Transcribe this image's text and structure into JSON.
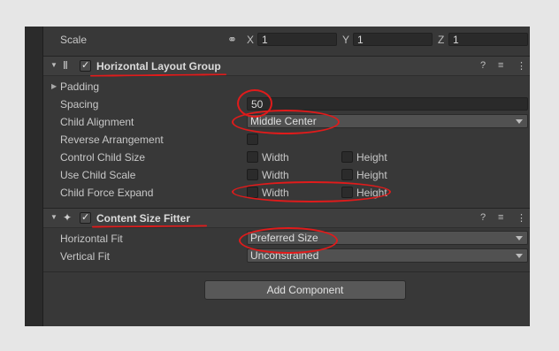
{
  "transform": {
    "scale_label": "Scale",
    "x_axis": "X",
    "x_value": "1",
    "y_axis": "Y",
    "y_value": "1",
    "z_axis": "Z",
    "z_value": "1"
  },
  "layout_group": {
    "title": "Horizontal Layout Group",
    "padding_label": "Padding",
    "spacing_label": "Spacing",
    "spacing_value": "50",
    "child_alignment_label": "Child Alignment",
    "child_alignment_value": "Middle Center",
    "reverse_label": "Reverse Arrangement",
    "control_child_size_label": "Control Child Size",
    "use_child_scale_label": "Use Child Scale",
    "child_force_expand_label": "Child Force Expand",
    "width_label": "Width",
    "height_label": "Height"
  },
  "size_fitter": {
    "title": "Content Size Fitter",
    "horizontal_fit_label": "Horizontal Fit",
    "horizontal_fit_value": "Preferred Size",
    "vertical_fit_label": "Vertical Fit",
    "vertical_fit_value": "Unconstrained"
  },
  "add_component_label": "Add Component",
  "icons": {
    "link": "⚭",
    "help": "?",
    "sliders": "≡",
    "more": "⋮",
    "layout": "Ⅱ",
    "fitter": "✦",
    "check": "✓",
    "fold_down": "▼",
    "fold_right": "▶"
  },
  "colors": {
    "annotation": "#e01b1b",
    "panel": "#383838",
    "page": "#e6e6e6"
  }
}
